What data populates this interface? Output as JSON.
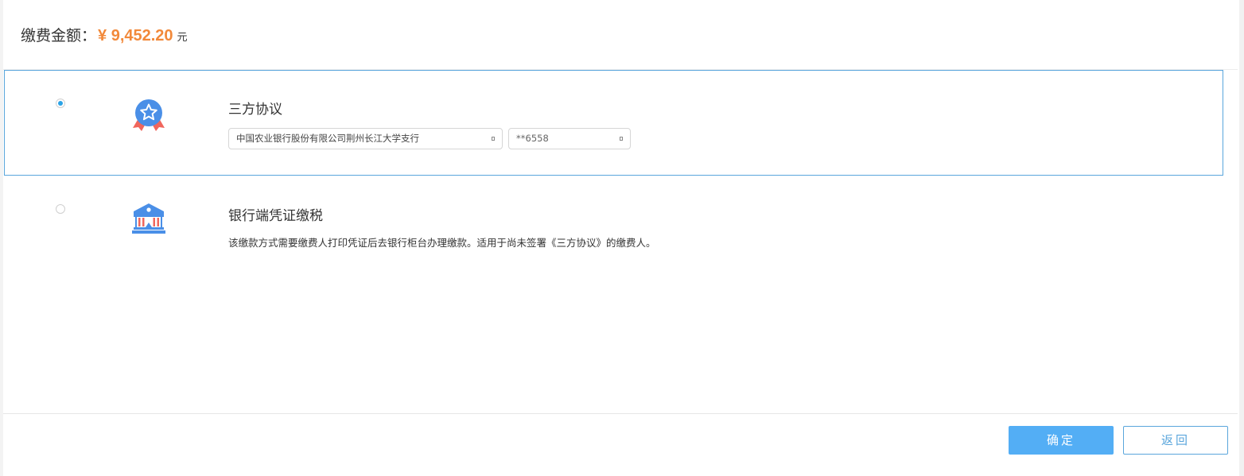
{
  "header": {
    "label": "缴费金额：",
    "amount": "¥ 9,452.20",
    "unit": "元"
  },
  "options": [
    {
      "title": "三方协议",
      "selected": true,
      "icon": "award-ribbon-icon",
      "bank_select": "中国农业银行股份有限公司荆州长江大学支行",
      "account_select": "**6558"
    },
    {
      "title": "银行端凭证缴税",
      "selected": false,
      "icon": "bank-building-icon",
      "description": "该缴款方式需要缴费人打印凭证后去银行柜台办理缴款。适用于尚未签署《三方协议》的缴费人。"
    }
  ],
  "buttons": {
    "confirm": "确定",
    "back": "返回"
  },
  "colors": {
    "amount": "#f2893a",
    "accent": "#53aef5",
    "selected_border": "#5aa6dc"
  }
}
